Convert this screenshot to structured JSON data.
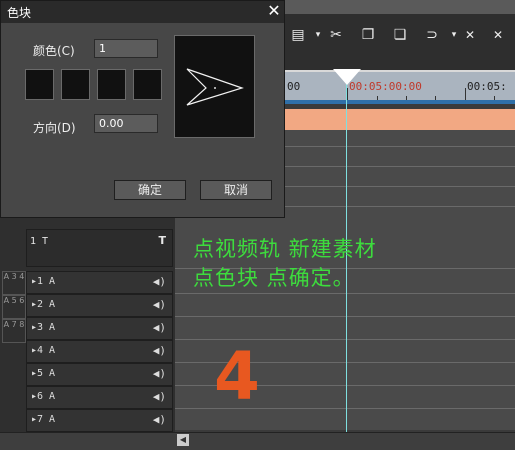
{
  "dialog": {
    "title": "色块",
    "close_glyph": "✕",
    "color_label": "颜色(C)",
    "color_count": "1",
    "direction_label": "方向(D)",
    "direction_value": "0.00",
    "ok_label": "确定",
    "cancel_label": "取消"
  },
  "ruler": {
    "timecode_left": "00",
    "timecode_current": "00:05:00:00",
    "timecode_right": "00:05:"
  },
  "tracks": {
    "title_track": "1 T",
    "title_icon": "T",
    "audio": [
      {
        "label": "▸1 A",
        "icon": "🔈"
      },
      {
        "label": "▸2 A",
        "icon": "🔈"
      },
      {
        "label": "▸3 A",
        "icon": "🔈"
      },
      {
        "label": "▸4 A",
        "icon": "🔈"
      },
      {
        "label": "▸5 A",
        "icon": "🔈"
      },
      {
        "label": "▸6 A",
        "icon": "🔈"
      },
      {
        "label": "▸7 A",
        "icon": "🔈"
      }
    ],
    "side_tags": [
      "A 3 4",
      "A 5 6",
      "A 7 8"
    ]
  },
  "overlay": {
    "instruction_line1": "点视频轨   新建素材",
    "instruction_line2": "点色块   点确定。",
    "step_number": "4"
  },
  "colors": {
    "accent_text": "#3ddc3d",
    "step_number": "#e85820",
    "cursor_line": "#7fe0e0",
    "clip": "#f2a883"
  },
  "icons": [
    "save-icon",
    "cut-icon",
    "copy-icon",
    "paste-icon",
    "link-icon",
    "trim-icon",
    "close-icon",
    "speaker-icon",
    "title-icon"
  ]
}
